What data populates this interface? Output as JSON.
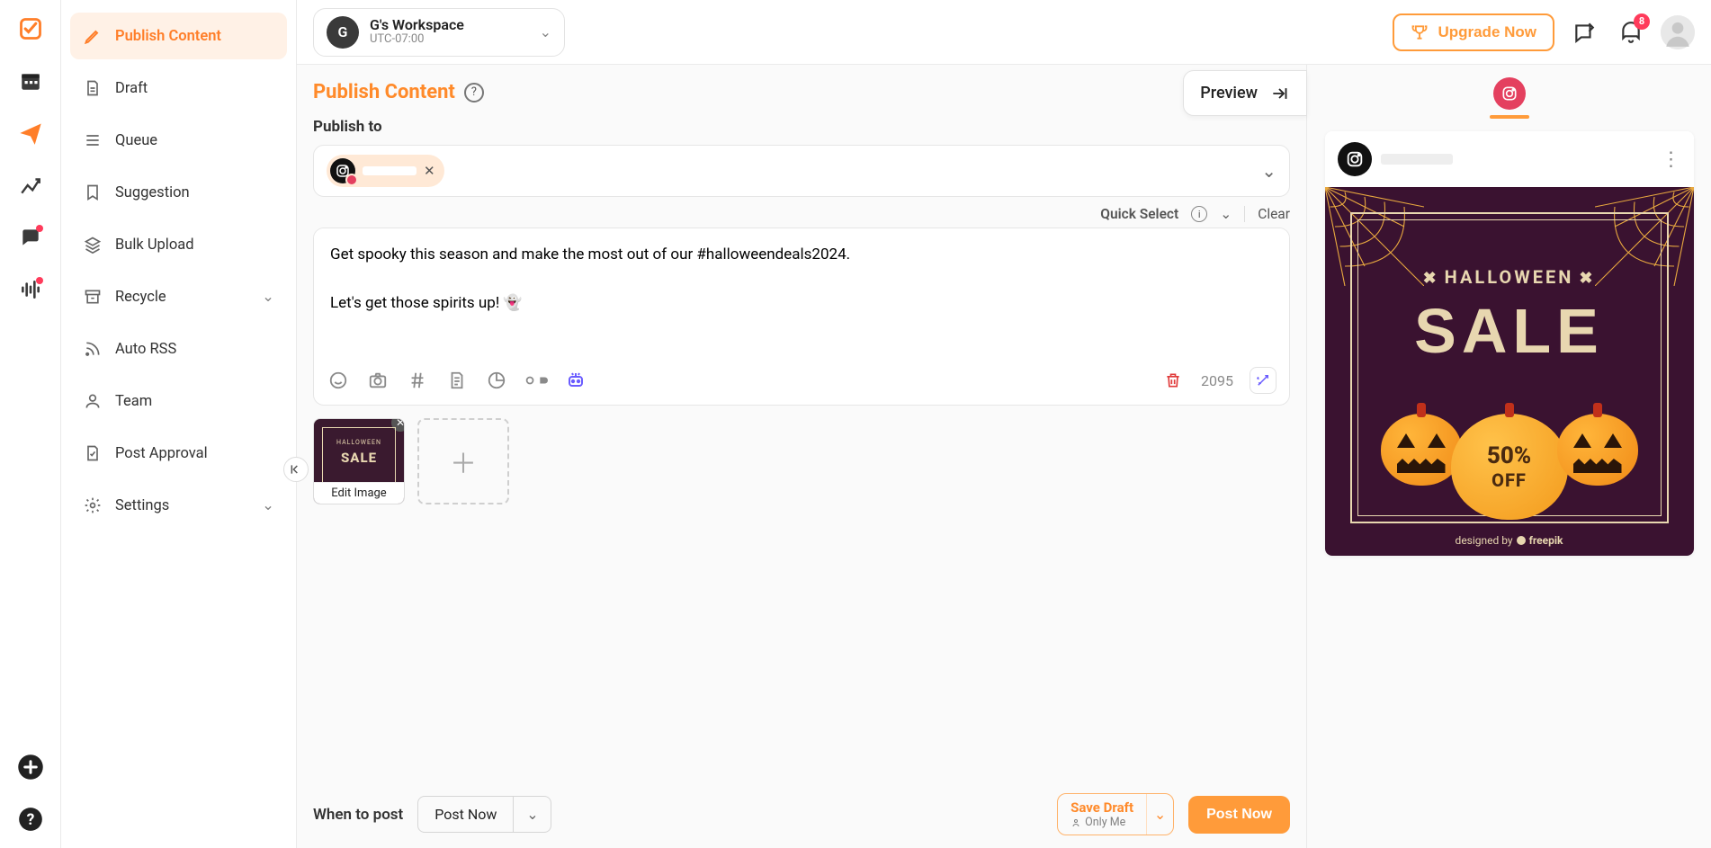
{
  "workspace": {
    "initial": "G",
    "name": "G's Workspace",
    "timezone": "UTC-07:00"
  },
  "topbar": {
    "upgrade": "Upgrade Now",
    "notification_count": "8"
  },
  "sidebar": {
    "items": [
      {
        "label": "Publish Content"
      },
      {
        "label": "Draft"
      },
      {
        "label": "Queue"
      },
      {
        "label": "Suggestion"
      },
      {
        "label": "Bulk Upload"
      },
      {
        "label": "Recycle"
      },
      {
        "label": "Auto RSS"
      },
      {
        "label": "Team"
      },
      {
        "label": "Post Approval"
      },
      {
        "label": "Settings"
      }
    ]
  },
  "page": {
    "title": "Publish Content",
    "preview_btn": "Preview"
  },
  "publish": {
    "section_label": "Publish to",
    "quick_select": "Quick Select",
    "clear": "Clear",
    "account_name": " "
  },
  "editor": {
    "text": "Get spooky this season and make the most out of our #halloweendeals2024.\n\nLet's get those spirits up! 👻",
    "char_count": "2095",
    "thumb_caption": "Edit Image",
    "thumb_title": "HALLOWEEN",
    "thumb_sale": "SALE"
  },
  "footer": {
    "when_label": "When to post",
    "post_now_option": "Post Now",
    "save_draft": "Save Draft",
    "only_me": "Only Me",
    "post_now_btn": "Post Now"
  },
  "preview": {
    "halloween": "HALLOWEEN",
    "sale": "SALE",
    "pct": "50%",
    "off": "OFF",
    "credit_prefix": "designed by ",
    "credit_brand": "freepik"
  }
}
